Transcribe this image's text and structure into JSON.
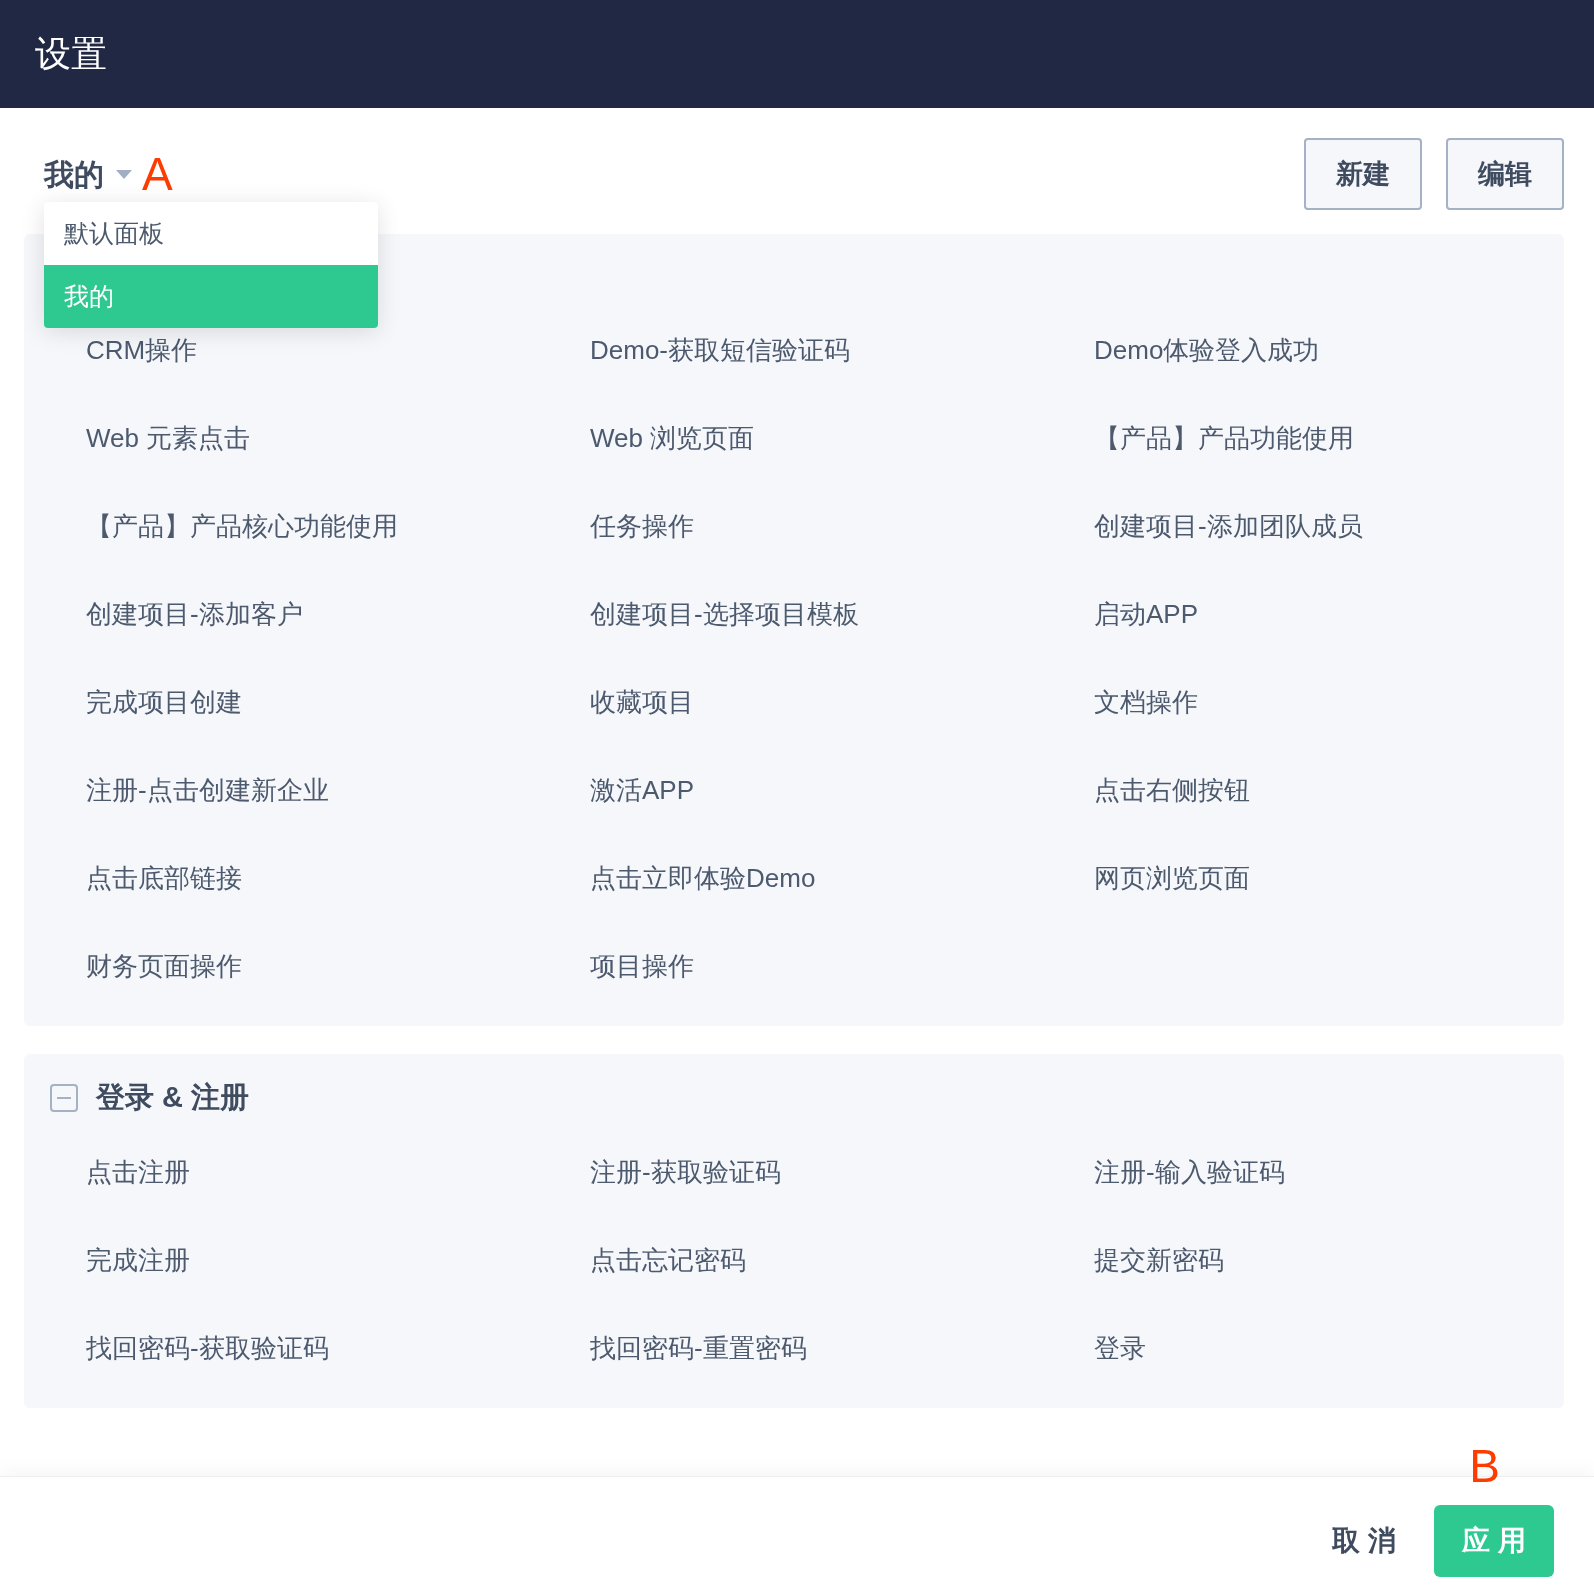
{
  "window": {
    "title": "设置"
  },
  "selector": {
    "label": "我的",
    "annotation": "A"
  },
  "dropdown": {
    "options": [
      {
        "label": "默认面板",
        "selected": false
      },
      {
        "label": "我的",
        "selected": true
      }
    ]
  },
  "toolbar_buttons": [
    "新建",
    "编辑"
  ],
  "groups": [
    {
      "items": [
        "CRM操作",
        "Demo-获取短信验证码",
        "Demo体验登入成功",
        "Web 元素点击",
        "Web 浏览页面",
        "【产品】产品功能使用",
        "【产品】产品核心功能使用",
        "任务操作",
        "创建项目-添加团队成员",
        "创建项目-添加客户",
        "创建项目-选择项目模板",
        "启动APP",
        "完成项目创建",
        "收藏项目",
        "文档操作",
        "注册-点击创建新企业",
        "激活APP",
        "点击右侧按钮",
        "点击底部链接",
        "点击立即体验Demo",
        "网页浏览页面",
        "财务页面操作",
        "项目操作"
      ]
    },
    {
      "title": "登录 & 注册",
      "expanded": true,
      "items": [
        "点击注册",
        "注册-获取验证码",
        "注册-输入验证码",
        "完成注册",
        "点击忘记密码",
        "提交新密码",
        "找回密码-获取验证码",
        "找回密码-重置密码",
        "登录"
      ]
    }
  ],
  "footer": {
    "cancel": "取 消",
    "apply": "应 用",
    "annotation": "B"
  }
}
